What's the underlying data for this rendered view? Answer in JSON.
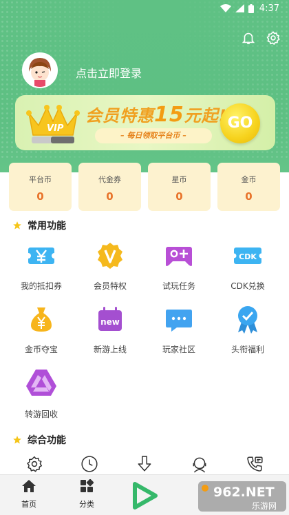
{
  "status": {
    "time": "4:37"
  },
  "header": {
    "login_text": "点击立即登录"
  },
  "vip_banner": {
    "badge": "VIP",
    "title_prefix": "会员特惠",
    "title_amount": "15",
    "title_suffix": "元起!",
    "subtitle": "– 每日领取平台币 –",
    "go_label": "GO"
  },
  "wallet": [
    {
      "label": "平台币",
      "value": "0"
    },
    {
      "label": "代金券",
      "value": "0"
    },
    {
      "label": "星币",
      "value": "0"
    },
    {
      "label": "金币",
      "value": "0"
    }
  ],
  "common": {
    "title": "常用功能",
    "items": [
      {
        "label": "我的抵扣券",
        "icon": "coupon-icon"
      },
      {
        "label": "会员特权",
        "icon": "vip-badge-icon"
      },
      {
        "label": "试玩任务",
        "icon": "gamepad-icon"
      },
      {
        "label": "CDK兑换",
        "icon": "cdk-icon"
      },
      {
        "label": "金币夺宝",
        "icon": "money-bag-icon"
      },
      {
        "label": "新游上线",
        "icon": "new-game-icon"
      },
      {
        "label": "玩家社区",
        "icon": "chat-icon"
      },
      {
        "label": "头衔福利",
        "icon": "medal-icon"
      },
      {
        "label": "转游回收",
        "icon": "recycle-icon"
      }
    ]
  },
  "general": {
    "title": "综合功能",
    "items": [
      "settings-icon",
      "clock-icon",
      "download-icon",
      "customer-service-icon",
      "phone-icon"
    ]
  },
  "nav": {
    "home": "首页",
    "category": "分类",
    "watermark": "962.NET 乐游网"
  },
  "colors": {
    "brand_green": "#5ec083",
    "card_bg": "#fdf2cf",
    "value_orange": "#e8732a"
  }
}
